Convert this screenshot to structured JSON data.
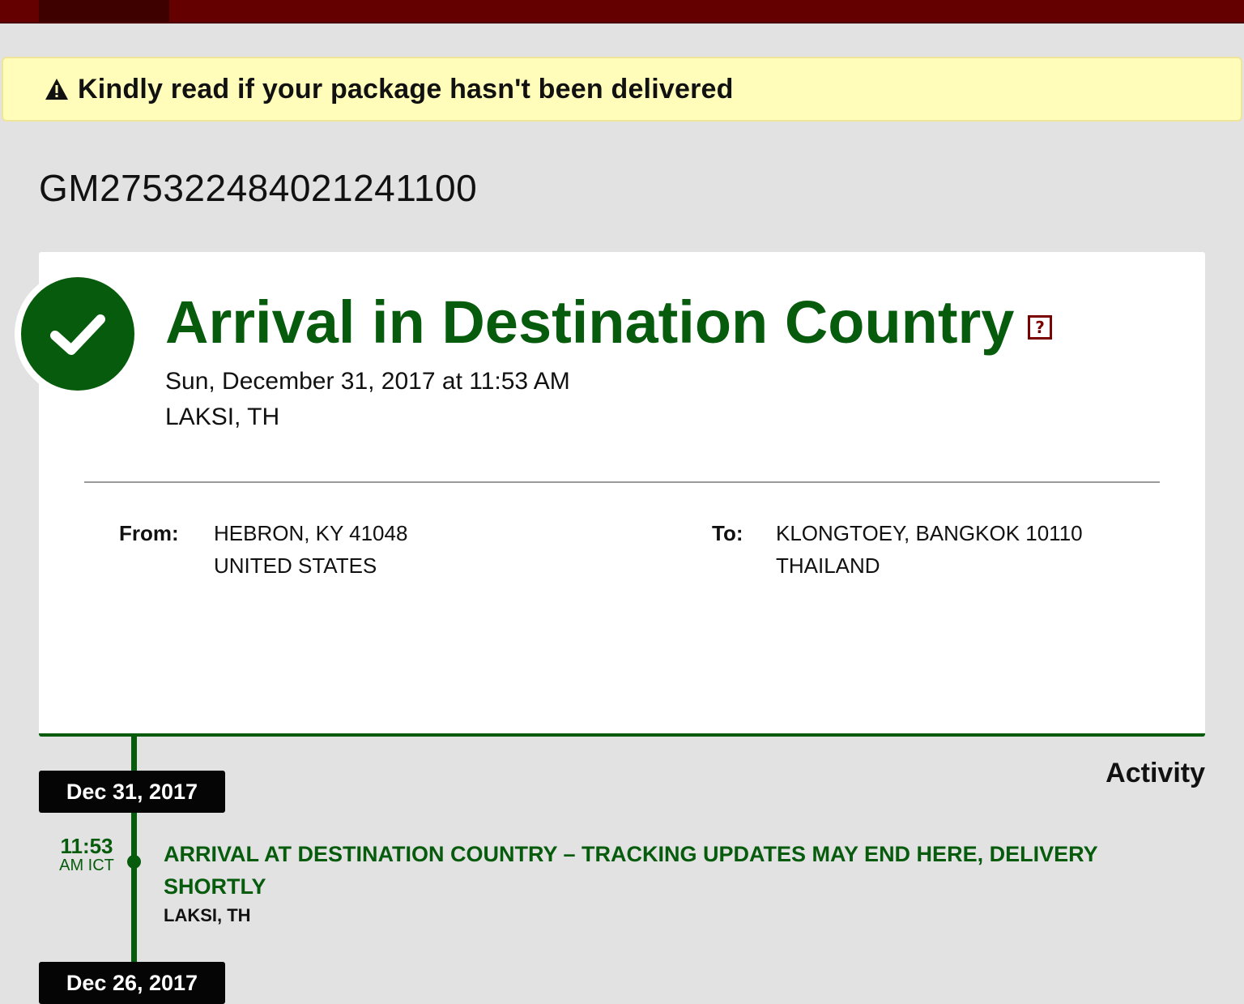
{
  "alert": {
    "icon": "warning-triangle-icon",
    "text": "Kindly read if your package hasn't been delivered"
  },
  "tracking": {
    "number": "GM275322484021241100"
  },
  "status": {
    "icon": "checkmark-icon",
    "title": "Arrival in Destination Country",
    "help_icon_text": "?",
    "datetime": "Sun, December 31, 2017 at 11:53 AM",
    "location": "LAKSI, TH",
    "accent_color": "#075b0c"
  },
  "shipment": {
    "from_label": "From:",
    "from_line1": "HEBRON, KY 41048",
    "from_line2": "UNITED STATES",
    "to_label": "To:",
    "to_line1": "KLONGTOEY, BANGKOK 10110",
    "to_line2": "THAILAND"
  },
  "activity": {
    "heading": "Activity",
    "groups": [
      {
        "date": "Dec 31, 2017",
        "events": [
          {
            "time": "11:53",
            "ampm_tz": "AM ICT",
            "description": "ARRIVAL AT DESTINATION COUNTRY – TRACKING UPDATES MAY END HERE, DELIVERY SHORTLY",
            "location": "LAKSI, TH"
          }
        ]
      },
      {
        "date": "Dec 26, 2017",
        "events": []
      }
    ]
  }
}
